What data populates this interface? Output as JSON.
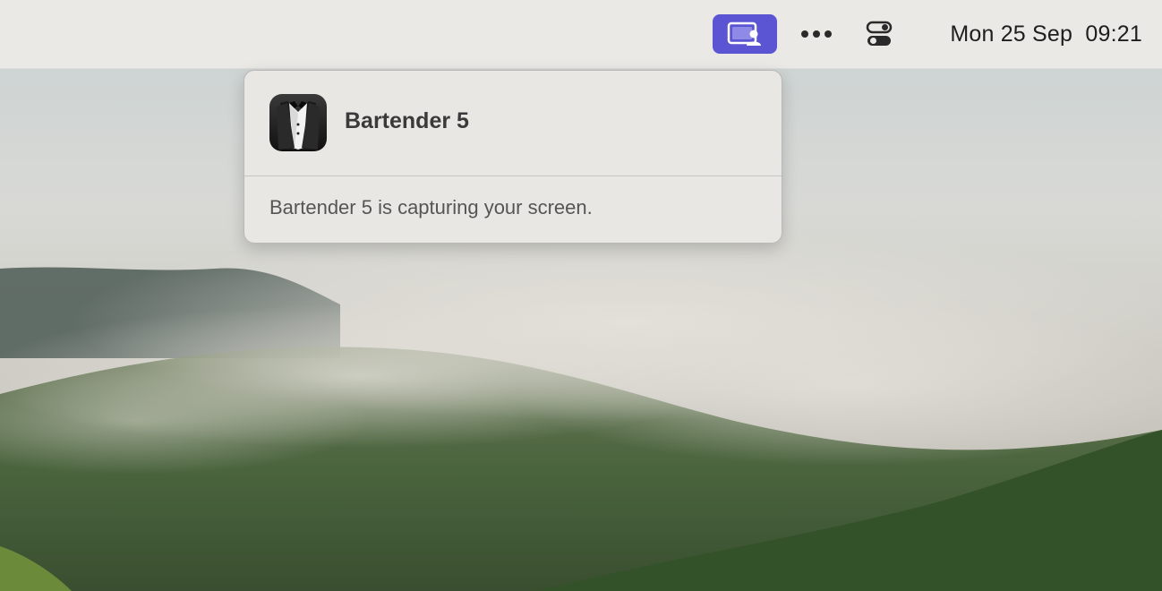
{
  "menubar": {
    "clock": "Mon 25 Sep  09:21",
    "screen_share_icon": "screen-sharing-icon",
    "more_icon": "ellipsis-icon",
    "control_center_icon": "control-center-icon",
    "active_color": "#5b55d3"
  },
  "popover": {
    "app_name": "Bartender 5",
    "app_icon": "bartender-tuxedo-icon",
    "message": "Bartender 5 is capturing your screen."
  }
}
